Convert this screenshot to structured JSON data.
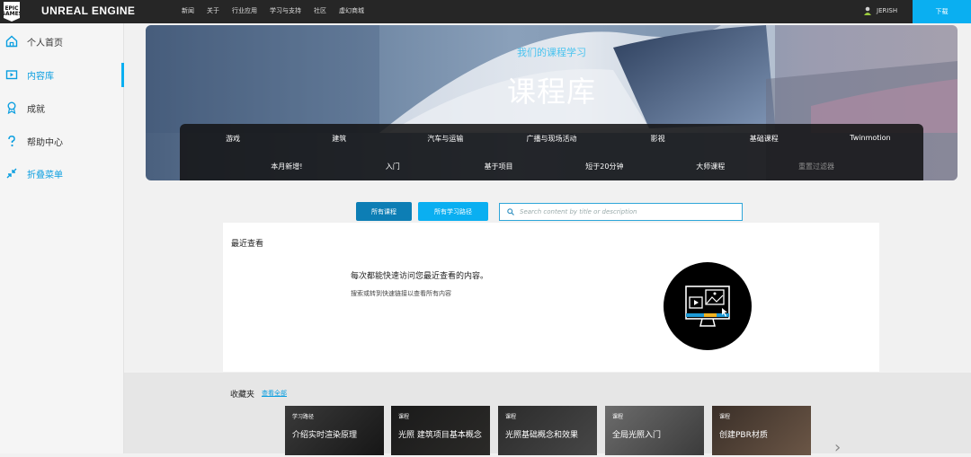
{
  "topbar": {
    "logo_text": "EPIC GAMES",
    "brand": "UNREAL ENGINE",
    "nav": [
      "新闻",
      "关于",
      "行业应用",
      "学习与支持",
      "社区",
      "虚幻商城"
    ],
    "user": "JERISH",
    "download": "下载"
  },
  "sidebar": {
    "items": [
      {
        "label": "个人首页",
        "icon": "home-icon"
      },
      {
        "label": "内容库",
        "icon": "library-icon"
      },
      {
        "label": "成就",
        "icon": "award-icon"
      },
      {
        "label": "帮助中心",
        "icon": "help-icon"
      }
    ],
    "collapse": "折叠菜单",
    "active_color": "#0aaff1"
  },
  "hero": {
    "subtitle": "我们的课程学习",
    "title": "课程库",
    "filters_row1": [
      "游戏",
      "建筑",
      "汽车与运输",
      "广播与现场活动",
      "影视",
      "基础课程",
      "Twinmotion"
    ],
    "filters_row2": [
      "本月新增!",
      "入门",
      "基于项目",
      "短于20分钟",
      "大师课程",
      "重置过滤器"
    ]
  },
  "tabs": {
    "all_courses": "所有课程",
    "all_paths": "所有学习路径"
  },
  "search": {
    "placeholder": "Search content by title or description"
  },
  "recent": {
    "heading": "最近查看",
    "message": "每次都能快速访问您最近查看的内容。",
    "hint": "搜索或转到快速链接以查看所有内容"
  },
  "favorites": {
    "heading": "收藏夹",
    "view_all": "查看全部",
    "cards": [
      {
        "type": "学习路径",
        "title": "介绍实时渲染原理"
      },
      {
        "type": "课程",
        "title": "光照 建筑项目基本概念"
      },
      {
        "type": "课程",
        "title": "光照基础概念和效果"
      },
      {
        "type": "课程",
        "title": "全局光照入门"
      },
      {
        "type": "课程",
        "title": "创建PBR材质"
      }
    ]
  },
  "colors": {
    "accent": "#0aaff1",
    "topbar": "#262626",
    "tab_dark": "#0d7eb5"
  }
}
